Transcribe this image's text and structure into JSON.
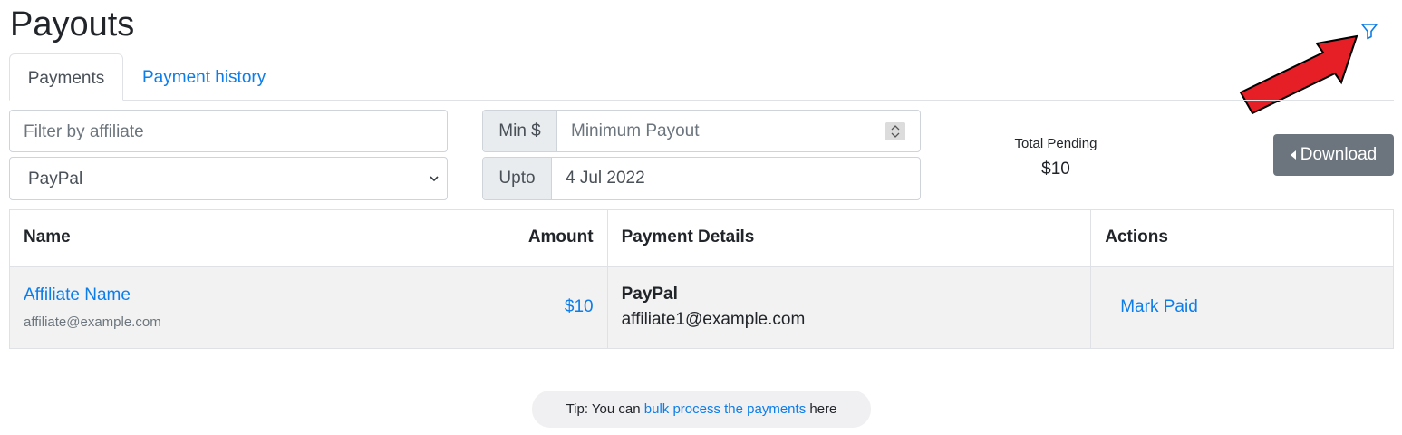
{
  "page": {
    "title": "Payouts"
  },
  "icons": {
    "filter": "filter-icon",
    "annotation": "red-arrow",
    "select": "chevron-down-icon",
    "download": "caret-left-icon"
  },
  "colors": {
    "link": "#0d7de9",
    "button": "#6c757d",
    "arrow": "#e61e26"
  },
  "tabs": [
    {
      "label": "Payments",
      "active": true
    },
    {
      "label": "Payment history",
      "active": false
    }
  ],
  "filters": {
    "affiliate_placeholder": "Filter by affiliate",
    "method_selected": "PayPal",
    "min_addon": "Min $",
    "min_placeholder": "Minimum Payout",
    "upto_addon": "Upto",
    "upto_value": "4 Jul 2022"
  },
  "summary": {
    "label": "Total Pending",
    "value": "$10"
  },
  "download_label": "Download",
  "table": {
    "headers": {
      "name": "Name",
      "amount": "Amount",
      "details": "Payment Details",
      "actions": "Actions"
    },
    "rows": [
      {
        "name": "Affiliate Name",
        "email": "affiliate@example.com",
        "amount": "$10",
        "method": "PayPal",
        "payment_email": "affiliate1@example.com",
        "action": "Mark Paid"
      }
    ]
  },
  "tip": {
    "prefix": "Tip: You can",
    "link": "bulk process the payments",
    "suffix": "here"
  }
}
